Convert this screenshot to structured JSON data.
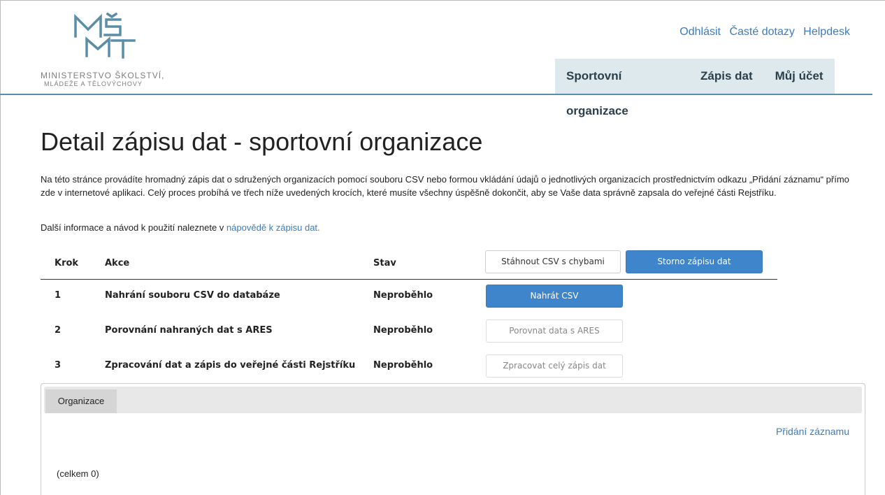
{
  "header": {
    "logo": {
      "mark": "MŠMT",
      "line1": "MINISTERSTVO ŠKOLSTVÍ,",
      "line2": "MLÁDEŽE A TĚLOVÝCHOVY"
    },
    "top_links": [
      "Odhlásit",
      "Časté dotazy",
      "Helpdesk"
    ],
    "nav": [
      "Sportovní organizace",
      "Zápis dat",
      "Můj účet"
    ]
  },
  "page": {
    "title": "Detail zápisu dat - sportovní organizace",
    "intro": "Na této stránce provádíte hromadný zápis dat o sdružených organizacích pomocí souboru CSV nebo formou vkládání údajů o jednotlivých organizacích prostřednictvím odkazu „Přidání záznamu“ přímo zde v internetové aplikaci. Celý proces probíhá ve třech níže uvedených krocích, které musíte všechny úspěšně dokončit, aby se Vaše data správně zapsala do veřejné části Rejstříku.",
    "help_prefix": "Další informace a návod k použití naleznete v ",
    "help_link": "nápovědě k zápisu dat."
  },
  "steps": {
    "headers": {
      "step": "Krok",
      "action": "Akce",
      "status": "Stav"
    },
    "download_errors": "Stáhnout CSV s chybami",
    "cancel": "Storno zápisu dat",
    "rows": [
      {
        "num": "1",
        "action": "Nahrání souboru CSV do databáze",
        "status": "Neproběhlo",
        "button": "Nahrát CSV"
      },
      {
        "num": "2",
        "action": "Porovnání nahraných dat s ARES",
        "status": "Neproběhlo",
        "button": "Porovnat data s ARES"
      },
      {
        "num": "3",
        "action": "Zpracování dat a zápis do veřejné části Rejstříku",
        "status": "Neproběhlo",
        "button": "Zpracovat celý zápis dat"
      }
    ]
  },
  "panel": {
    "tab": "Organizace",
    "add_link": "Přidání záznamu",
    "total": "(celkem 0)"
  },
  "colors": {
    "accent": "#3f85cb",
    "nav_bg": "#dde9ed",
    "header_line": "#5a8ea6",
    "logo": "#5a8ea6"
  }
}
